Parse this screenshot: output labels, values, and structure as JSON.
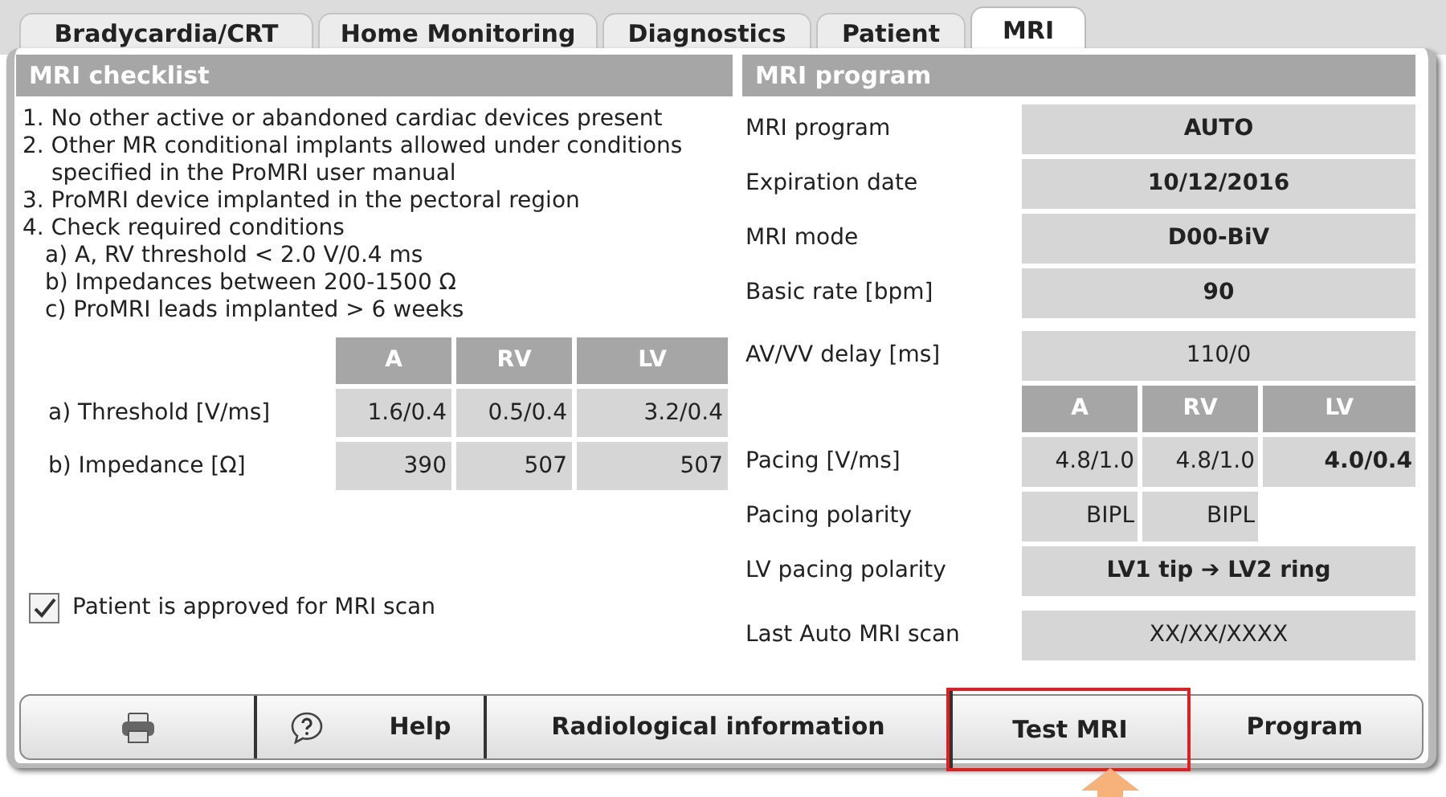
{
  "tabs": [
    {
      "label": "Bradycardia/CRT",
      "selected": false
    },
    {
      "label": "Home Monitoring",
      "selected": false
    },
    {
      "label": "Diagnostics",
      "selected": false
    },
    {
      "label": "Patient",
      "selected": false
    },
    {
      "label": "MRI",
      "selected": true
    }
  ],
  "checklist": {
    "title": "MRI checklist",
    "items": [
      {
        "text": "1. No other active or abandoned cardiac devices present"
      },
      {
        "text": "2. Other MR conditional implants allowed under conditions specified in the ProMRI user manual"
      },
      {
        "text": "3. ProMRI device implanted in the pectoral region"
      },
      {
        "text": "4. Check required conditions",
        "children": [
          {
            "text": "a) A, RV threshold < 2.0 V/0.4 ms"
          },
          {
            "text": "b) Impedances between 200-1500 Ω"
          },
          {
            "text": "c) ProMRI leads implanted > 6 weeks"
          }
        ]
      }
    ],
    "table": {
      "columns": [
        "A",
        "RV",
        "LV"
      ],
      "rows": [
        {
          "label": "a) Threshold [V/ms]",
          "values": [
            "1.6/0.4",
            "0.5/0.4",
            "3.2/0.4"
          ]
        },
        {
          "label": "b) Impedance [Ω]",
          "values": [
            "390",
            "507",
            "507"
          ]
        }
      ]
    },
    "approval": {
      "label": "Patient is approved for MRI scan",
      "checked": true
    }
  },
  "program": {
    "title": "MRI program",
    "fields": [
      {
        "label": "MRI program",
        "value": "AUTO",
        "bold": true
      },
      {
        "label": "Expiration date",
        "value": "10/12/2016",
        "bold": true
      },
      {
        "label": "MRI mode",
        "value": "D00-BiV",
        "bold": true
      },
      {
        "label": "Basic rate [bpm]",
        "value": "90",
        "bold": true
      },
      {
        "label": "AV/VV delay [ms]",
        "value": "110/0",
        "bold": false
      }
    ],
    "table": {
      "columns": [
        "A",
        "RV",
        "LV"
      ],
      "rows": [
        {
          "label": "Pacing [V/ms]",
          "values": [
            {
              "text": "4.8/1.0",
              "bold": false
            },
            {
              "text": "4.8/1.0",
              "bold": false
            },
            {
              "text": "4.0/0.4",
              "bold": true
            }
          ]
        },
        {
          "label": "Pacing polarity",
          "values": [
            {
              "text": "BIPL",
              "bold": false
            },
            {
              "text": "BIPL",
              "bold": false
            }
          ]
        }
      ]
    },
    "fields_after": [
      {
        "label": "LV pacing polarity",
        "value": "LV1 tip ➔ LV2 ring",
        "bold": true
      },
      {
        "label": "Last Auto MRI scan",
        "value": "XX/XX/XXXX",
        "bold": false
      }
    ]
  },
  "buttons": [
    {
      "kind": "print",
      "highlighted": false
    },
    {
      "kind": "help",
      "label": "Help",
      "highlighted": false
    },
    {
      "kind": "text",
      "label": "Radiological information",
      "highlighted": false
    },
    {
      "kind": "text",
      "label": "Test MRI",
      "highlighted": true
    },
    {
      "kind": "text",
      "label": "Program",
      "highlighted": false
    }
  ]
}
